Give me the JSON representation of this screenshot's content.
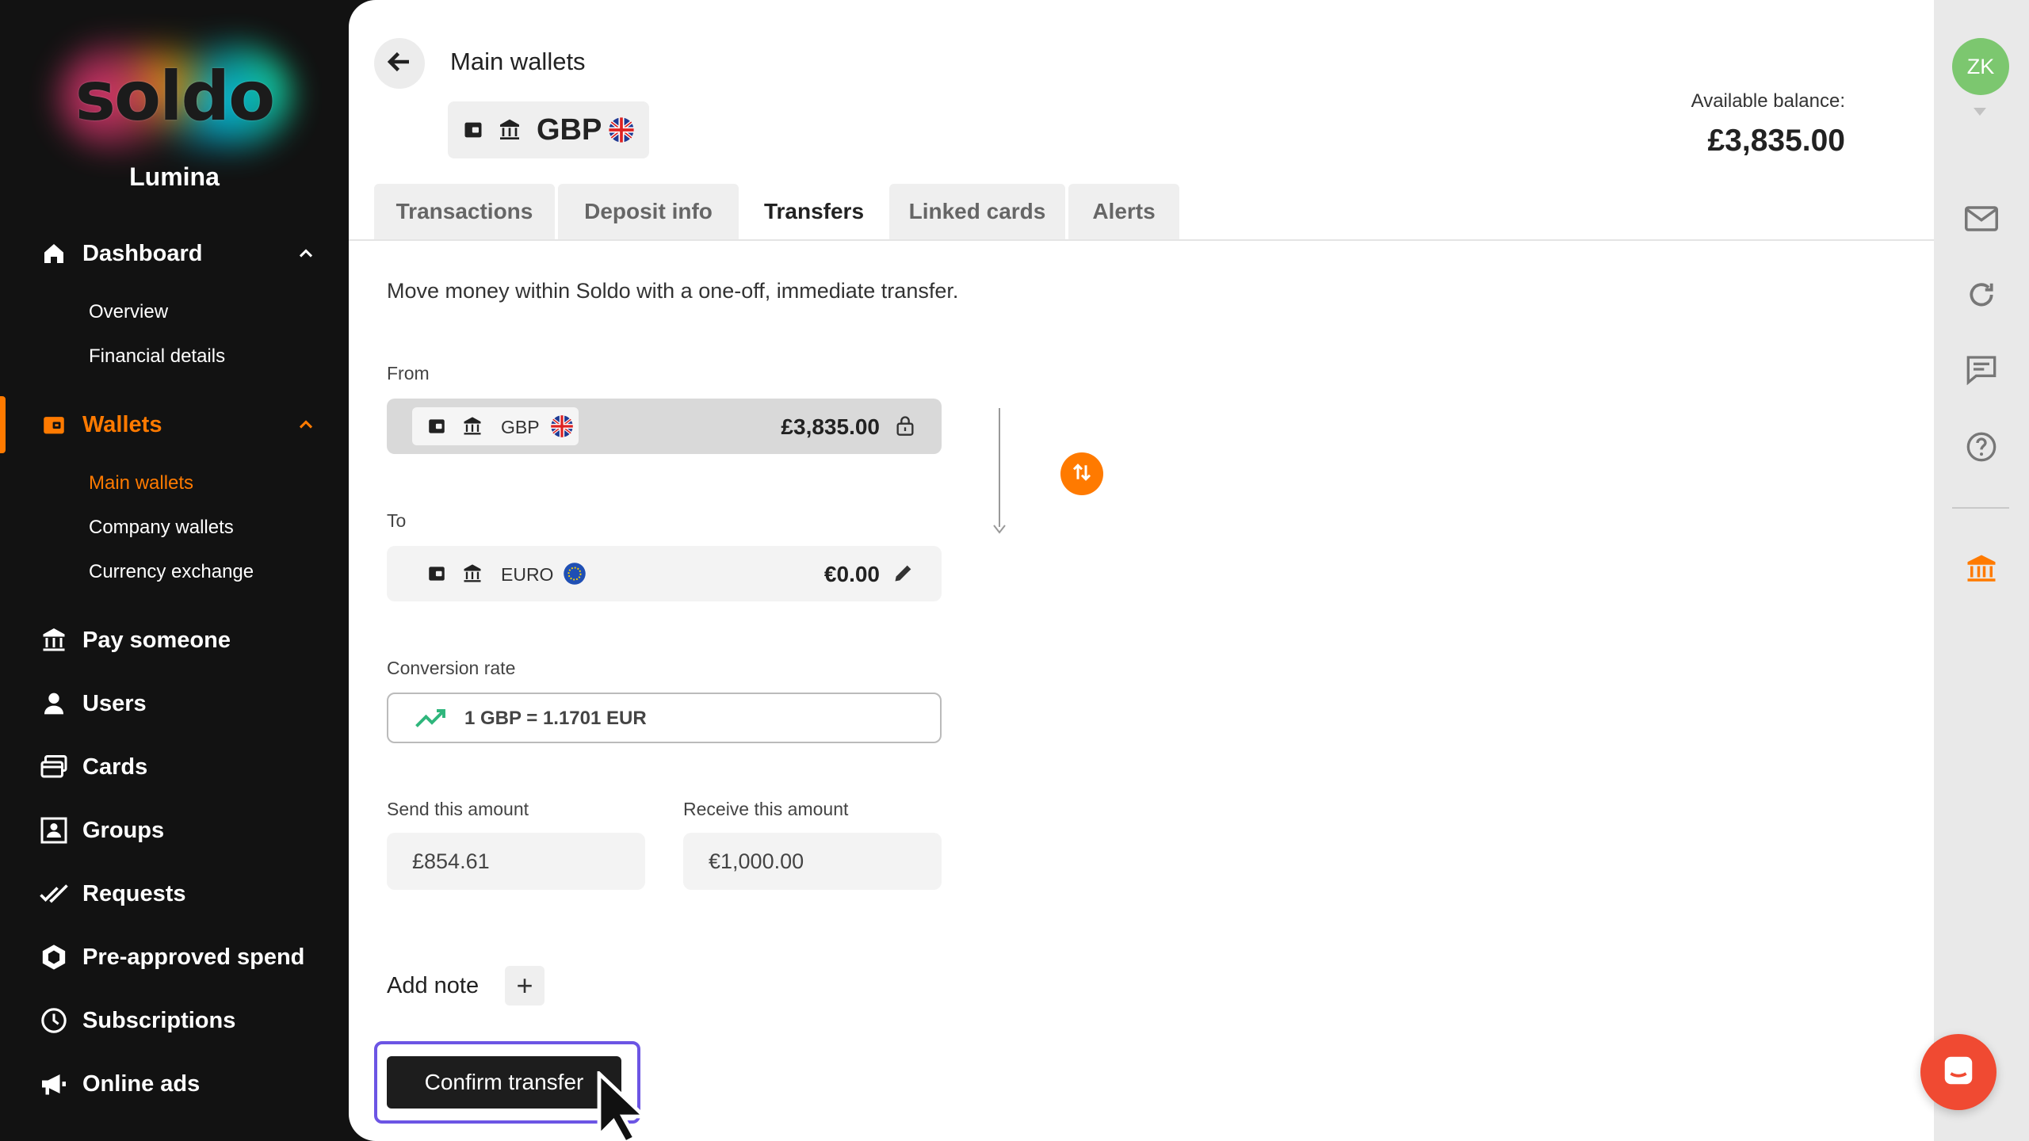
{
  "brand": {
    "logo_text": "soldo",
    "company": "Lumina"
  },
  "sidebar": {
    "items": [
      {
        "label": "Dashboard",
        "icon": "home-icon",
        "expanded": true,
        "children": [
          {
            "label": "Overview"
          },
          {
            "label": "Financial details"
          }
        ]
      },
      {
        "label": "Wallets",
        "icon": "wallet-icon",
        "expanded": true,
        "active": true,
        "children": [
          {
            "label": "Main wallets",
            "active": true
          },
          {
            "label": "Company wallets"
          },
          {
            "label": "Currency exchange"
          }
        ]
      },
      {
        "label": "Pay someone",
        "icon": "bank-transfer-icon"
      },
      {
        "label": "Users",
        "icon": "user-icon"
      },
      {
        "label": "Cards",
        "icon": "cards-icon"
      },
      {
        "label": "Groups",
        "icon": "groups-icon"
      },
      {
        "label": "Requests",
        "icon": "double-check-icon"
      },
      {
        "label": "Pre-approved spend",
        "icon": "hexagon-icon"
      },
      {
        "label": "Subscriptions",
        "icon": "clock-icon"
      },
      {
        "label": "Online ads",
        "icon": "megaphone-icon"
      }
    ]
  },
  "header": {
    "title": "Main wallets",
    "wallet_currency": "GBP",
    "available_balance_label": "Available balance:",
    "available_balance": "£3,835.00"
  },
  "tabs": [
    {
      "label": "Transactions"
    },
    {
      "label": "Deposit info"
    },
    {
      "label": "Transfers",
      "active": true
    },
    {
      "label": "Linked cards"
    },
    {
      "label": "Alerts"
    }
  ],
  "transfer": {
    "intro": "Move money within Soldo with a one-off, immediate transfer.",
    "from_label": "From",
    "from_currency": "GBP",
    "from_amount": "£3,835.00",
    "to_label": "To",
    "to_currency": "EURO",
    "to_amount": "€0.00",
    "rate_label": "Conversion rate",
    "rate_value": "1 GBP = 1.1701 EUR",
    "send_label": "Send this amount",
    "send_value": "£854.61",
    "receive_label": "Receive this amount",
    "receive_value": "€1,000.00",
    "add_note_label": "Add note",
    "add_note_button": "+",
    "confirm_label": "Confirm transfer"
  },
  "rail": {
    "avatar_initials": "ZK"
  },
  "colors": {
    "accent": "#ff7a00",
    "sidebar_bg": "#121212",
    "focus_ring": "#6c55e4",
    "chat": "#f04a32",
    "avatar": "#7cc76f"
  }
}
